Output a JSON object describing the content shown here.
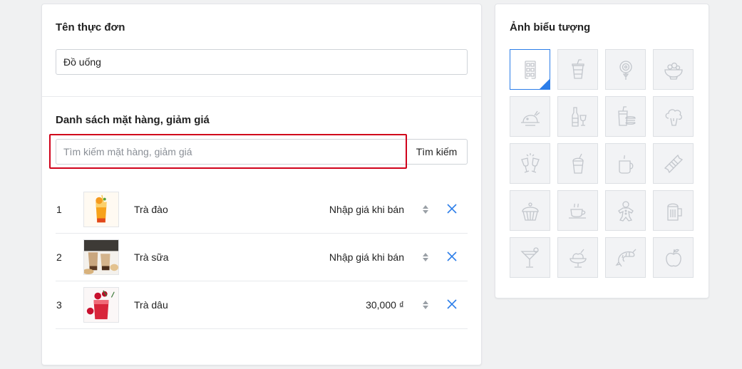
{
  "menu_name": {
    "label": "Tên thực đơn",
    "value": "Đồ uống"
  },
  "items_section": {
    "label": "Danh sách mặt hàng, giảm giá",
    "search_placeholder": "Tìm kiếm mặt hàng, giảm giá",
    "search_button": "Tìm kiếm"
  },
  "items": [
    {
      "index": "1",
      "name": "Trà đào",
      "price": "Nhập giá khi bán"
    },
    {
      "index": "2",
      "name": "Trà sữa",
      "price": "Nhập giá khi bán"
    },
    {
      "index": "3",
      "name": "Trà dâu",
      "price": "30,000 ₫"
    }
  ],
  "icon_panel": {
    "label": "Ảnh biểu tượng",
    "selected_icon": "grid-chocolate-icon",
    "icons": [
      "grid-chocolate-icon",
      "drink-cup-icon",
      "lollipop-icon",
      "salad-bowl-icon",
      "roast-chicken-icon",
      "wine-bottle-icon",
      "fast-food-icon",
      "broccoli-icon",
      "cheers-glasses-icon",
      "smoothie-icon",
      "hot-mug-icon",
      "candy-icon",
      "cupcake-icon",
      "coffee-cup-icon",
      "gingerbread-icon",
      "beer-mug-icon",
      "cocktail-icon",
      "ice-cream-icon",
      "shrimp-icon",
      "apple-icon"
    ]
  },
  "colors": {
    "accent": "#2b7de9",
    "highlight": "#d0021b",
    "icon_stroke": "#c2c6cc"
  }
}
